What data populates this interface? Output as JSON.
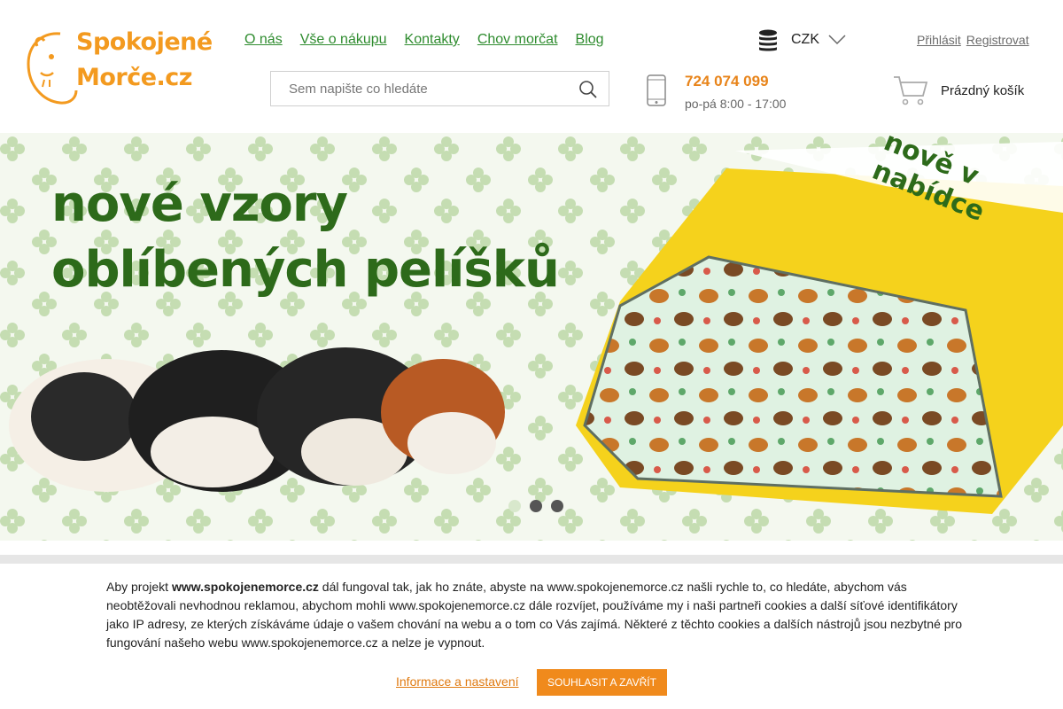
{
  "logo": {
    "line1": "Spokojené",
    "line2": "Morče.cz"
  },
  "nav": [
    {
      "label": "O nás"
    },
    {
      "label": "Vše o nákupu"
    },
    {
      "label": "Kontakty"
    },
    {
      "label": "Chov morčat"
    },
    {
      "label": "Blog"
    }
  ],
  "currency": {
    "selected": "CZK"
  },
  "auth": {
    "login": "Přihlásit",
    "register": "Registrovat"
  },
  "search": {
    "placeholder": "Sem napište co hledáte",
    "value": ""
  },
  "contact": {
    "phone": "724 074 099",
    "hours": "po-pá 8:00 - 17:00"
  },
  "cart": {
    "label": "Prázdný košík"
  },
  "banner": {
    "headline1": "nové vzory",
    "headline2": "oblíbených pelíšků",
    "ribbon": "nově v nabídce",
    "slide_count": 3,
    "active_slide": 1
  },
  "cookie": {
    "intro": "Aby projekt ",
    "site_bold": "www.spokojenemorce.cz",
    "rest": " dál fungoval tak, jak ho znáte, abyste na www.spokojenemorce.cz našli rychle to, co hledáte, abychom vás neobtěžovali nevhodnou reklamou, abychom mohli www.spokojenemorce.cz dále rozvíjet, používáme my i naši partneři cookies a další síťové identifikátory jako IP adresy, ze kterých získáváme údaje o vašem chování na webu a o tom co Vás zajímá. Některé z těchto cookies a dalších nástrojů jsou nezbytné pro fungování našeho webu www.spokojenemorce.cz a nelze je vypnout.",
    "settings_link": "Informace a nastavení",
    "accept_button": "Souhlasit a zavřít"
  },
  "colors": {
    "brand_orange": "#f39a1f",
    "nav_green": "#2f8c2f",
    "headline_green": "#2d6a1a"
  },
  "icons": [
    "guinea-pig-logo-icon",
    "search-icon",
    "coins-icon",
    "chevron-down-icon",
    "phone-icon",
    "cart-icon"
  ]
}
